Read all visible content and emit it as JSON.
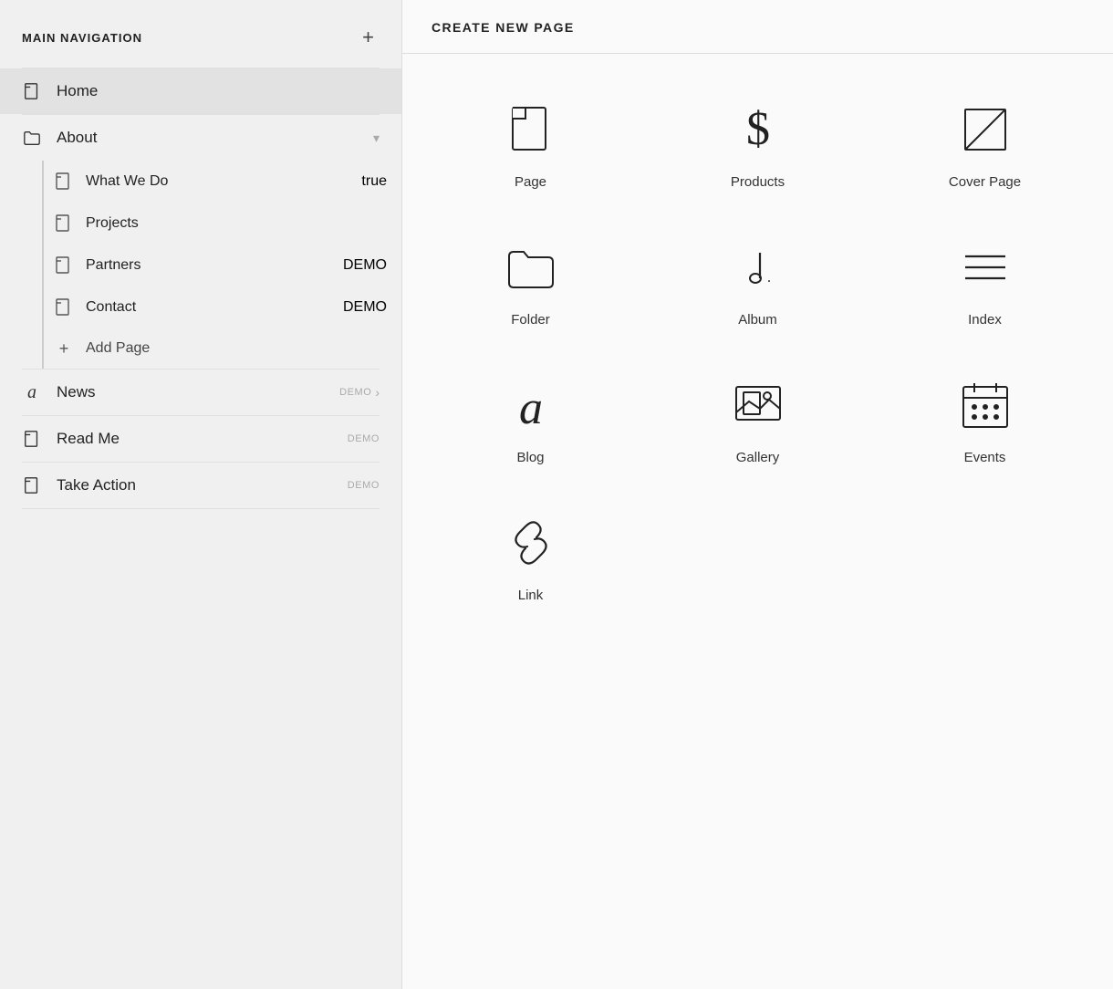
{
  "sidebar": {
    "header": {
      "title": "MAIN NAVIGATION",
      "add_button_label": "+"
    },
    "nav_items": [
      {
        "id": "home",
        "label": "Home",
        "type": "page",
        "active": true,
        "demo": false,
        "has_chevron": false
      },
      {
        "id": "about",
        "label": "About",
        "type": "folder",
        "active": false,
        "demo": false,
        "has_chevron": true,
        "chevron": "▾",
        "children": [
          {
            "id": "what-we-do",
            "label": "What We Do",
            "type": "page",
            "demo": true
          },
          {
            "id": "projects",
            "label": "Projects",
            "type": "page",
            "demo": false
          },
          {
            "id": "partners",
            "label": "Partners",
            "type": "page",
            "demo": true
          },
          {
            "id": "contact-sub",
            "label": "Contact",
            "type": "page",
            "demo": true
          }
        ],
        "add_page_label": "Add Page"
      },
      {
        "id": "news",
        "label": "News",
        "type": "blog",
        "active": false,
        "demo": true,
        "has_chevron": true,
        "chevron": "›"
      },
      {
        "id": "read-me",
        "label": "Read Me",
        "type": "page",
        "active": false,
        "demo": true,
        "has_chevron": false
      },
      {
        "id": "take-action",
        "label": "Take Action",
        "type": "page",
        "active": false,
        "demo": true,
        "has_chevron": false
      }
    ]
  },
  "right_panel": {
    "title": "CREATE NEW PAGE",
    "page_types": [
      {
        "id": "page",
        "label": "Page"
      },
      {
        "id": "products",
        "label": "Products"
      },
      {
        "id": "cover-page",
        "label": "Cover Page"
      },
      {
        "id": "folder",
        "label": "Folder"
      },
      {
        "id": "album",
        "label": "Album"
      },
      {
        "id": "index",
        "label": "Index"
      },
      {
        "id": "blog",
        "label": "Blog"
      },
      {
        "id": "gallery",
        "label": "Gallery"
      },
      {
        "id": "events",
        "label": "Events"
      },
      {
        "id": "link",
        "label": "Link"
      }
    ]
  }
}
